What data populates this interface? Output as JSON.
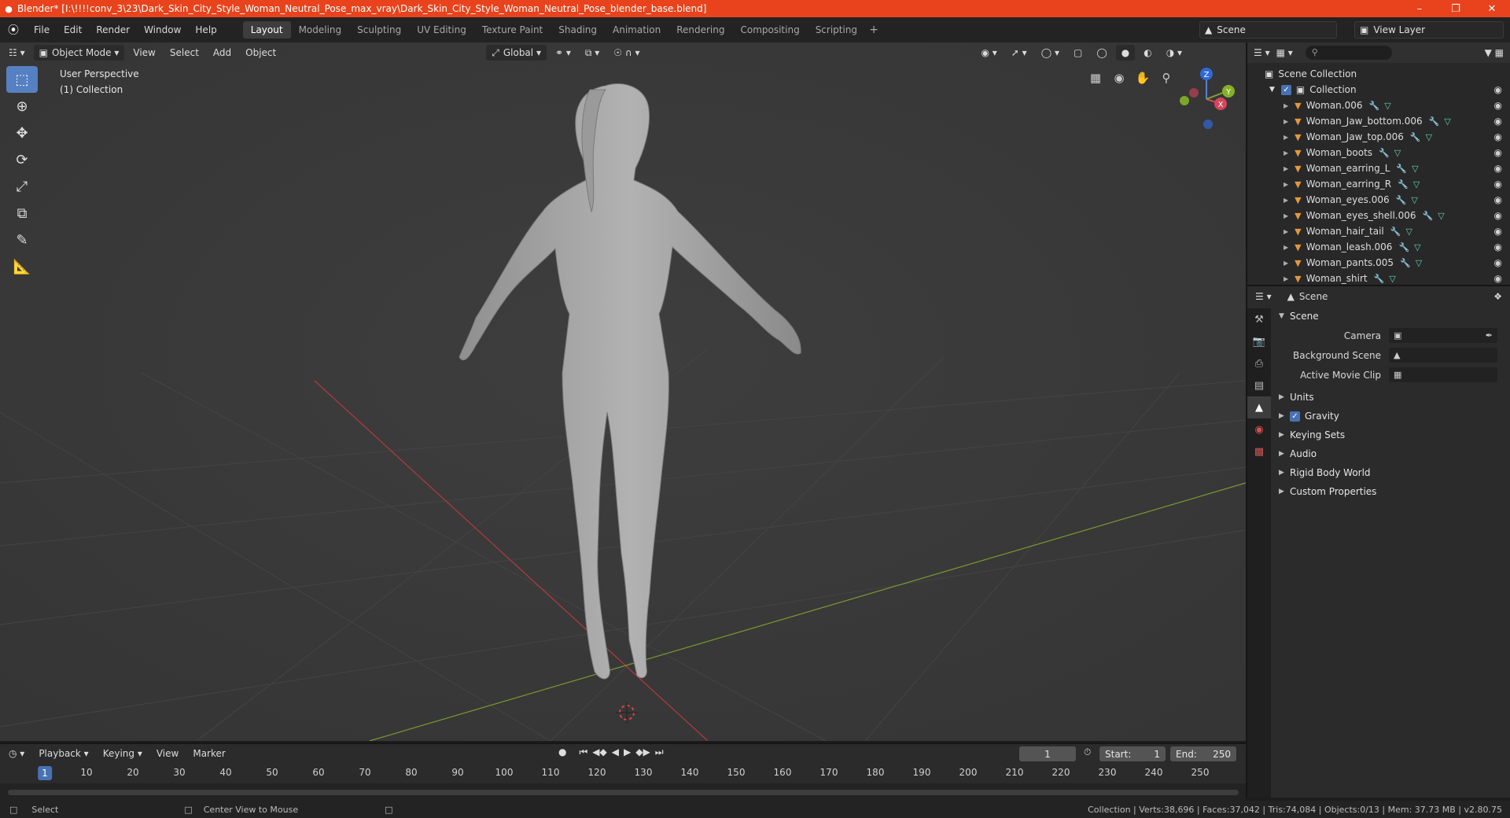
{
  "window": {
    "title": "Blender* [I:\\!!!!conv_3\\23\\Dark_Skin_City_Style_Woman_Neutral_Pose_max_vray\\Dark_Skin_City_Style_Woman_Neutral_Pose_blender_base.blend]"
  },
  "menu": [
    "File",
    "Edit",
    "Render",
    "Window",
    "Help"
  ],
  "workspaces": [
    "Layout",
    "Modeling",
    "Sculpting",
    "UV Editing",
    "Texture Paint",
    "Shading",
    "Animation",
    "Rendering",
    "Compositing",
    "Scripting"
  ],
  "scene_name": "Scene",
  "view_layer": "View Layer",
  "viewport": {
    "mode": "Object Mode",
    "menus": [
      "View",
      "Select",
      "Add",
      "Object"
    ],
    "transform_orientation": "Global",
    "info_line1": "User Perspective",
    "info_line2": "(1) Collection",
    "gizmo_z": "Z",
    "gizmo_y": "Y",
    "gizmo_x": "X"
  },
  "outliner": {
    "root": "Scene Collection",
    "collection": "Collection",
    "objects": [
      "Woman.006",
      "Woman_Jaw_bottom.006",
      "Woman_Jaw_top.006",
      "Woman_boots",
      "Woman_earring_L",
      "Woman_earring_R",
      "Woman_eyes.006",
      "Woman_eyes_shell.006",
      "Woman_hair_tail",
      "Woman_leash.006",
      "Woman_pants.005",
      "Woman_shirt"
    ]
  },
  "properties": {
    "header": "Scene",
    "panel": "Scene",
    "camera_label": "Camera",
    "background_scene_label": "Background Scene",
    "active_movie_clip_label": "Active Movie Clip",
    "sections": [
      "Units",
      "Gravity",
      "Keying Sets",
      "Audio",
      "Rigid Body World",
      "Custom Properties"
    ]
  },
  "timeline": {
    "menus": [
      "Playback",
      "Keying",
      "View",
      "Marker"
    ],
    "current_frame": "1",
    "start_label": "Start:",
    "start": "1",
    "end_label": "End:",
    "end": "250",
    "ruler": [
      "10",
      "20",
      "30",
      "40",
      "50",
      "60",
      "70",
      "80",
      "90",
      "100",
      "110",
      "120",
      "130",
      "140",
      "150",
      "160",
      "170",
      "180",
      "190",
      "200",
      "210",
      "220",
      "230",
      "240",
      "250"
    ]
  },
  "status": {
    "left": "Select",
    "middle": "Center View to Mouse",
    "stats": "Collection | Verts:38,696 | Faces:37,042 | Tris:74,084 | Objects:0/13 | Mem: 37.73 MB | v2.80.75"
  }
}
